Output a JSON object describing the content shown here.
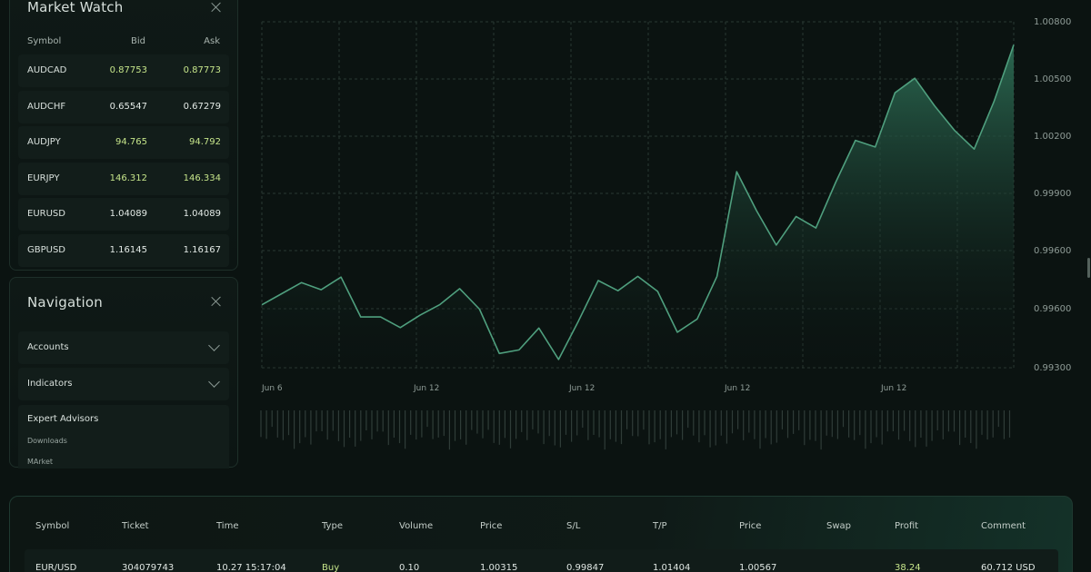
{
  "market_watch": {
    "title": "Market Watch",
    "columns": {
      "symbol": "Symbol",
      "bid": "Bid",
      "ask": "Ask"
    },
    "rows": [
      {
        "symbol": "AUDCAD",
        "bid": "0.87753",
        "ask": "0.87773",
        "highlight": true
      },
      {
        "symbol": "AUDCHF",
        "bid": "0.65547",
        "ask": "0.67279",
        "highlight": false
      },
      {
        "symbol": "AUDJPY",
        "bid": "94.765",
        "ask": "94.792",
        "highlight": true
      },
      {
        "symbol": "EURJPY",
        "bid": "146.312",
        "ask": "146.334",
        "highlight": true
      },
      {
        "symbol": "EURUSD",
        "bid": "1.04089",
        "ask": "1.04089",
        "highlight": false
      },
      {
        "symbol": "GBPUSD",
        "bid": "1.16145",
        "ask": "1.16167",
        "highlight": false
      }
    ]
  },
  "navigation": {
    "title": "Navigation",
    "items": [
      {
        "label": "Accounts"
      },
      {
        "label": "Indicators"
      }
    ],
    "expert_advisors": {
      "label": "Expert Advisors",
      "children": [
        "Downloads",
        "MArket"
      ]
    }
  },
  "chart_data": {
    "type": "area",
    "title": "",
    "xlabel": "",
    "ylabel": "",
    "x_ticks": [
      "Jun 6",
      "Jun 12",
      "Jun 12",
      "Jun 12",
      "Jun 12"
    ],
    "y_ticks": [
      "1.00800",
      "1.00500",
      "1.00200",
      "0.99900",
      "0.99600",
      "0.99600",
      "0.99300"
    ],
    "ylim": [
      0.993,
      1.008
    ],
    "grid": true,
    "series": [
      {
        "values": [
          0.99573,
          0.99621,
          0.99669,
          0.99638,
          0.99693,
          0.9952,
          0.9952,
          0.99474,
          0.99528,
          0.99574,
          0.99643,
          0.99554,
          0.99362,
          0.99377,
          0.99472,
          0.99336,
          0.99502,
          0.99678,
          0.99634,
          0.99696,
          0.99631,
          0.99454,
          0.99511,
          0.99696,
          1.0015,
          0.99981,
          0.99832,
          0.99956,
          0.99906,
          1.00103,
          1.00286,
          1.00257,
          1.00492,
          1.00555,
          1.00436,
          1.0033,
          1.00248,
          1.00453,
          1.007
        ]
      }
    ],
    "colors": {
      "line": "#4f9f7e",
      "fill_top": "#2c6b53",
      "grid": "#2a3833"
    }
  },
  "trades": {
    "columns": [
      "Symbol",
      "Ticket",
      "Time",
      "Type",
      "Volume",
      "Price",
      "S/L",
      "T/P",
      "Price",
      "Swap",
      "Profit",
      "Comment"
    ],
    "rows": [
      [
        "EUR/USD",
        "304079743",
        "10.27 15:17:04",
        "Buy",
        "0.10",
        "1.00315",
        "0.99847",
        "1.01404",
        "1.00567",
        "",
        "38.24",
        "60.712 USD"
      ]
    ]
  }
}
